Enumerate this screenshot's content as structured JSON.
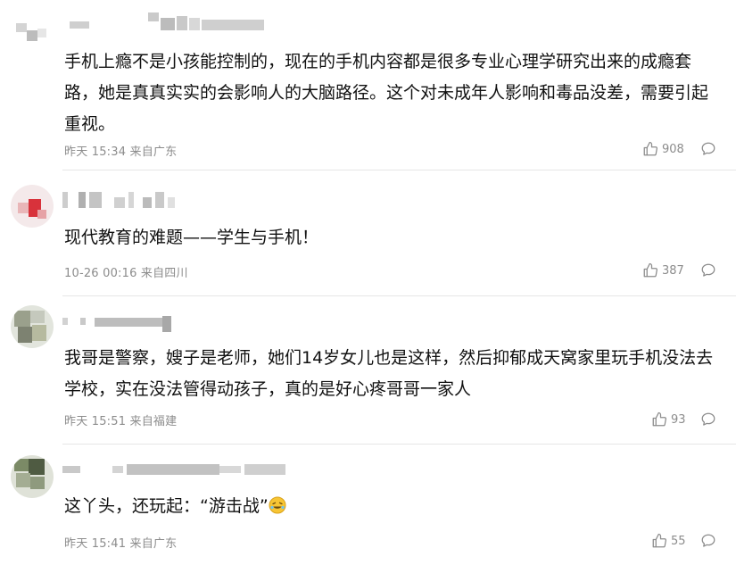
{
  "comments": [
    {
      "text": "手机上瘾不是小孩能控制的，现在的手机内容都是很多专业心理学研究出来的成瘾套路，她是真真实实的会影响人的大脑路径。这个对未成年人影响和毒品没差，需要引起重视。",
      "meta": "昨天 15:34 来自广东",
      "likes": "908"
    },
    {
      "text": "现代教育的难题——学生与手机！",
      "meta": "10-26 00:16 来自四川",
      "likes": "387"
    },
    {
      "text": "我哥是警察，嫂子是老师，她们14岁女儿也是这样，然后抑郁成天窝家里玩手机没法去学校，实在没法管得动孩子，真的是好心疼哥哥一家人",
      "meta": "昨天 15:51 来自福建",
      "likes": "93"
    },
    {
      "text": "这丫头，还玩起：“游击战”",
      "meta": "昨天 15:41 来自广东",
      "likes": "55",
      "emoji_icon": "laughing-emoji-icon"
    }
  ],
  "icons": {
    "like": "thumbs-up-icon",
    "reply": "comment-bubble-icon"
  },
  "colors": {
    "text": "#111111",
    "meta": "#8c8c8c",
    "divider": "#e6e6e6"
  }
}
